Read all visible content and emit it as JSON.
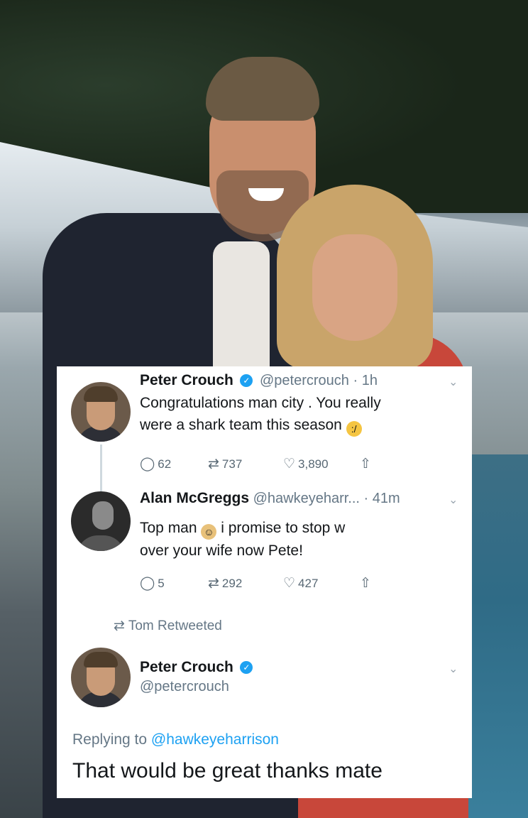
{
  "tweets": [
    {
      "name": "Peter Crouch",
      "handle": "@petercrouch",
      "time": "· 1h",
      "text_line1": "Congratulations man city . You really",
      "text_line2": "were a shark team this season",
      "replies": "62",
      "retweets": "737",
      "likes": "3,890"
    },
    {
      "name": "Alan McGreggs",
      "handle": "@hawkeyeharr...",
      "time": "· 41m",
      "text_line1_a": "Top man",
      "text_line1_b": "i promise to stop w",
      "text_line2": "over your wife now Pete!",
      "replies": "5",
      "retweets": "292",
      "likes": "427"
    }
  ],
  "retweet_notice": "Tom Retweeted",
  "reply_tweet": {
    "name": "Peter Crouch",
    "handle": "@petercrouch",
    "replying_label": "Replying to",
    "replying_to": "@hawkeyeharrison",
    "text": "That would be great thanks mate"
  },
  "icons": {
    "reply": "reply-icon",
    "retweet": "retweet-icon",
    "like": "heart-icon",
    "share": "share-icon",
    "verified": "verified-badge-icon",
    "chevron": "chevron-down-icon"
  },
  "colors": {
    "verified": "#1da1f2",
    "mention": "#1da1f2",
    "secondary_text": "#657786"
  }
}
